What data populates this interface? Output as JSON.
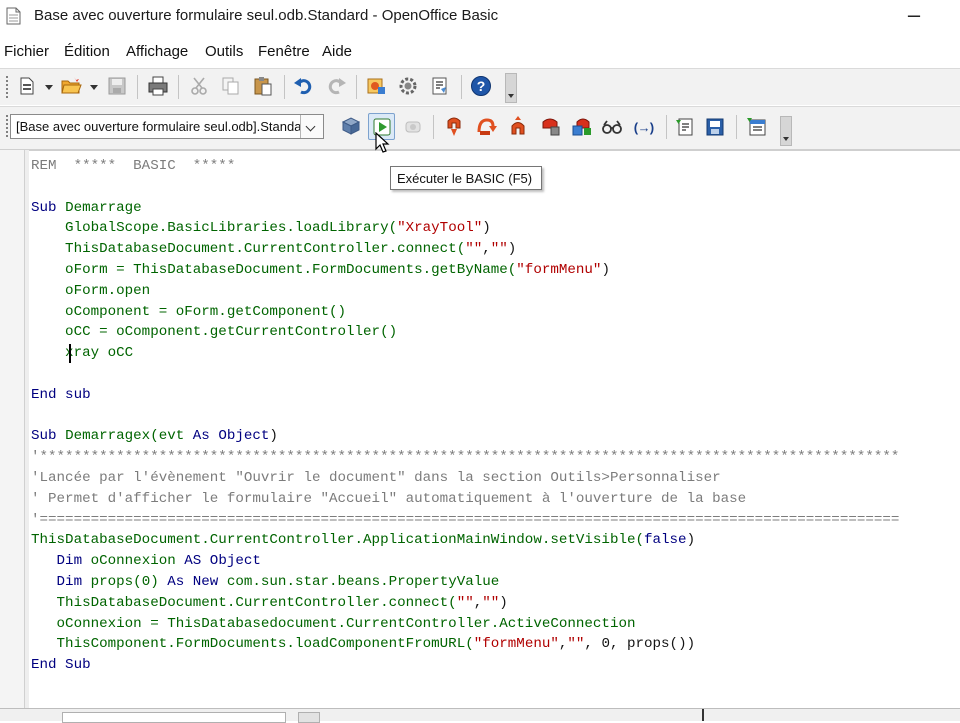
{
  "window": {
    "title": "Base avec ouverture formulaire seul.odb.Standard - OpenOffice Basic",
    "minimize_glyph": "–"
  },
  "menu": {
    "items": [
      "Fichier",
      "Édition",
      "Affichage",
      "Outils",
      "Fenêtre",
      "Aide"
    ]
  },
  "toolbar_standard": {
    "buttons": [
      "new-document-icon",
      "open-folder-icon",
      "save-icon",
      "print-icon",
      "cut-icon",
      "copy-icon",
      "paste-icon",
      "undo-icon",
      "redo-icon",
      "select-module-icon",
      "macro-gear-icon",
      "dialog-icon",
      "help-icon"
    ]
  },
  "toolbar_macro": {
    "library_select": "[Base avec ouverture formulaire seul.odb].Standard",
    "run_tooltip": "Exécuter le BASIC (F5)",
    "buttons": [
      "compile-icon",
      "run-basic-icon",
      "stop-icon",
      "step-into-icon",
      "step-over-icon",
      "step-out-icon",
      "breakpoint-icon",
      "manage-breakpoints-icon",
      "watch-icon",
      "find-parentheses-icon",
      "insert-source-icon",
      "save-source-icon",
      "import-dialog-icon"
    ]
  },
  "colors": {
    "keyword": "#000080",
    "identifier": "#006400",
    "string": "#b00000",
    "comment": "#7c7c7c"
  },
  "code": {
    "lines": [
      [
        {
          "t": "REM  *****  BASIC  *****",
          "c": "cm"
        }
      ],
      [],
      [
        {
          "t": "Sub ",
          "c": "kw"
        },
        {
          "t": "Demarrage",
          "c": "id"
        }
      ],
      [
        {
          "t": "    GlobalScope.BasicLibraries.loadLibrary(",
          "c": "id"
        },
        {
          "t": "\"XrayTool\"",
          "c": "str"
        },
        {
          "t": ")",
          "c": "txt"
        }
      ],
      [
        {
          "t": "    ThisDatabaseDocument.CurrentController.connect(",
          "c": "id"
        },
        {
          "t": "\"\"",
          "c": "str"
        },
        {
          "t": ",",
          "c": "txt"
        },
        {
          "t": "\"\"",
          "c": "str"
        },
        {
          "t": ")",
          "c": "txt"
        }
      ],
      [
        {
          "t": "    oForm = ThisDatabaseDocument.FormDocuments.getByName(",
          "c": "id"
        },
        {
          "t": "\"formMenu\"",
          "c": "str"
        },
        {
          "t": ")",
          "c": "txt"
        }
      ],
      [
        {
          "t": "    oForm.open",
          "c": "id"
        }
      ],
      [
        {
          "t": "    oComponent = oForm.getComponent()",
          "c": "id"
        }
      ],
      [
        {
          "t": "    oCC = oComponent.getCurrentController()",
          "c": "id"
        }
      ],
      [
        {
          "t": "    xray oCC",
          "c": "id"
        }
      ],
      [],
      [
        {
          "t": "End sub",
          "c": "kw"
        }
      ],
      [],
      [
        {
          "t": "Sub ",
          "c": "kw"
        },
        {
          "t": "Demarragex(evt ",
          "c": "id"
        },
        {
          "t": "As Object",
          "c": "kw"
        },
        {
          "t": ")",
          "c": "txt"
        }
      ],
      [
        {
          "t": "'*****************************************************************************************************",
          "c": "cm"
        }
      ],
      [
        {
          "t": "'Lancée par l'évènement \"Ouvrir le document\" dans la section Outils>Personnaliser",
          "c": "cm"
        }
      ],
      [
        {
          "t": "' Permet d'afficher le formulaire \"Accueil\" automatiquement à l'ouverture de la base",
          "c": "cm"
        }
      ],
      [
        {
          "t": "'=====================================================================================================",
          "c": "cm"
        }
      ],
      [
        {
          "t": "ThisDatabaseDocument.CurrentController.ApplicationMainWindow.setVisible(",
          "c": "id"
        },
        {
          "t": "false",
          "c": "kw"
        },
        {
          "t": ")",
          "c": "txt"
        }
      ],
      [
        {
          "t": "   Dim ",
          "c": "kw"
        },
        {
          "t": "oConnexion ",
          "c": "id"
        },
        {
          "t": "AS Object",
          "c": "kw"
        }
      ],
      [
        {
          "t": "   Dim ",
          "c": "kw"
        },
        {
          "t": "props(0) ",
          "c": "id"
        },
        {
          "t": "As New ",
          "c": "kw"
        },
        {
          "t": "com.sun.star.beans.PropertyValue",
          "c": "id"
        }
      ],
      [
        {
          "t": "   ThisDatabaseDocument.CurrentController.connect(",
          "c": "id"
        },
        {
          "t": "\"\"",
          "c": "str"
        },
        {
          "t": ",",
          "c": "txt"
        },
        {
          "t": "\"\"",
          "c": "str"
        },
        {
          "t": ")",
          "c": "txt"
        }
      ],
      [
        {
          "t": "   oConnexion = ThisDatabasedocument.CurrentController.ActiveConnection",
          "c": "id"
        }
      ],
      [
        {
          "t": "   ThisComponent.FormDocuments.loadComponentFromURL(",
          "c": "id"
        },
        {
          "t": "\"formMenu\"",
          "c": "str"
        },
        {
          "t": ",",
          "c": "txt"
        },
        {
          "t": "\"\"",
          "c": "str"
        },
        {
          "t": ", 0, props())",
          "c": "txt"
        }
      ],
      [
        {
          "t": "End Sub",
          "c": "kw"
        }
      ]
    ]
  }
}
